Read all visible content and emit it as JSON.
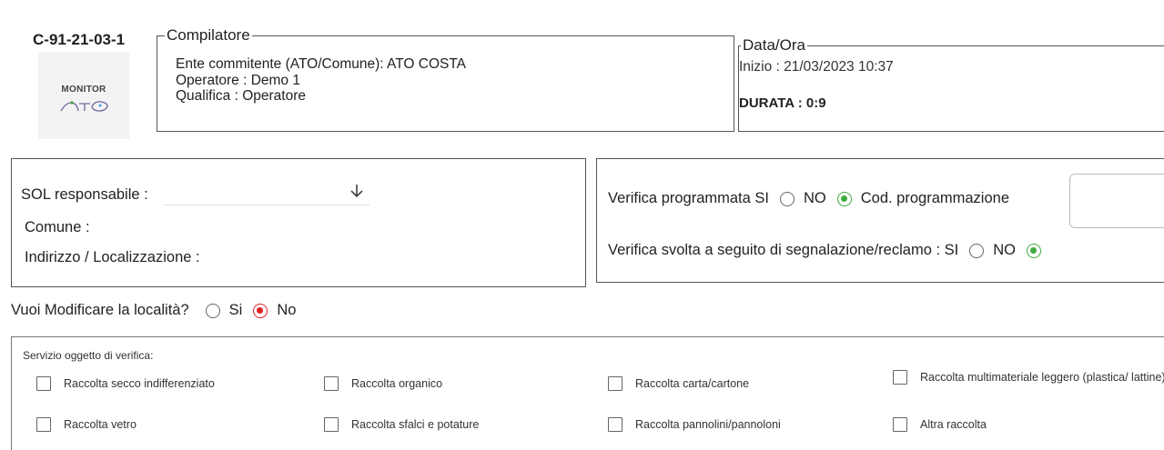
{
  "header": {
    "code": "C-91-21-03-1",
    "logo_text": "MONITOR",
    "compilatore": {
      "legend": "Compilatore",
      "ente": "Ente commitente (ATO/Comune): ATO COSTA",
      "operatore": "Operatore : Demo 1",
      "qualifica": "Qualifica : Operatore"
    },
    "data_ora": {
      "legend": "Data/Ora",
      "inizio": "Inizio : 21/03/2023 10:37",
      "durata": "DURATA : 0:9"
    }
  },
  "location": {
    "sol_label": "SOL responsabile :",
    "sol_value": "",
    "comune_label": "Comune :",
    "indirizzo_label": "Indirizzo / Localizzazione :"
  },
  "verifica": {
    "programmata_label": "Verifica programmata SI",
    "no_label": "NO",
    "cod_label": "Cod. programmazione",
    "cod_value": "",
    "segnalazione_label": "Verifica svolta a seguito di segnalazione/reclamo : SI",
    "no2_label": "NO",
    "selected_color": "#3faa3f"
  },
  "modifica": {
    "question": "Vuoi Modificare la località?",
    "si_label": "Si",
    "no_label": "No",
    "selected_color": "#e02020"
  },
  "servizio": {
    "title": "Servizio oggetto di verifica:",
    "items": [
      "Raccolta secco indifferenziato",
      "Raccolta organico",
      "Raccolta carta/cartone",
      "Raccolta multimateriale leggero (plastica/ lattine)",
      "Raccolta vetro",
      "Raccolta sfalci e potature",
      "Raccolta pannolini/pannoloni",
      "Altra raccolta"
    ]
  }
}
